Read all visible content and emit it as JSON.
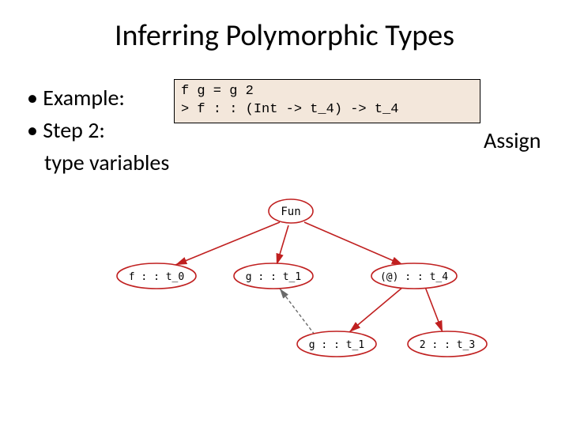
{
  "title": "Inferring Polymorphic Types",
  "bullet1": "Example:",
  "bullet2": "Step 2:",
  "bullet2_cont": "type variables",
  "right_label": "Assign",
  "code": {
    "line1": "f g = g 2",
    "line2": "> f : : (Int -> t_4) -> t_4"
  },
  "nodes": {
    "fun": "Fun",
    "f": "f : : t_0",
    "g": "g : : t_1",
    "app": "(@) : : t_4",
    "g2": "g : : t_1",
    "two": "2 : : t_3"
  },
  "colors": {
    "nodeStroke": "#c02020",
    "solidEdge": "#c02020",
    "dashedEdge": "#6a6a6a",
    "nodeFill": "#ffffff"
  }
}
